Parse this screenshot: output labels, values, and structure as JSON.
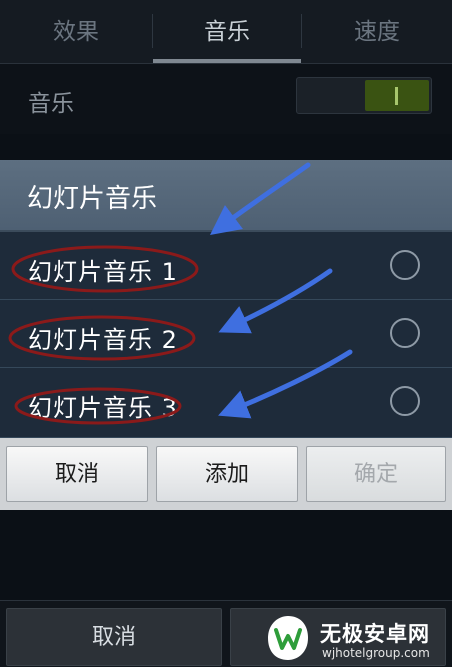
{
  "tabs": [
    {
      "label": "效果",
      "active": false
    },
    {
      "label": "音乐",
      "active": true
    },
    {
      "label": "速度",
      "active": false
    }
  ],
  "settings": {
    "music_label": "音乐",
    "music_toggle_on": true,
    "toggle_glyph": "I"
  },
  "dialog": {
    "title": "幻灯片音乐",
    "options": [
      {
        "label": "幻灯片音乐 1",
        "selected": false
      },
      {
        "label": "幻灯片音乐 2",
        "selected": false
      },
      {
        "label": "幻灯片音乐 3",
        "selected": false
      }
    ],
    "buttons": {
      "cancel": "取消",
      "add": "添加",
      "confirm": "确定",
      "confirm_enabled": false
    }
  },
  "bottom_bar": {
    "cancel": "取消"
  },
  "annotations": {
    "arrow_color": "#3f6fe0",
    "ellipse_color": "#8b1a1a"
  },
  "watermark": {
    "name": "无极安卓网",
    "url": "wjhotelgroup.com"
  },
  "colors": {
    "accent_green": "#3a5312",
    "dialog_header": "#566a7e",
    "dialog_body": "#1f2d3d"
  }
}
